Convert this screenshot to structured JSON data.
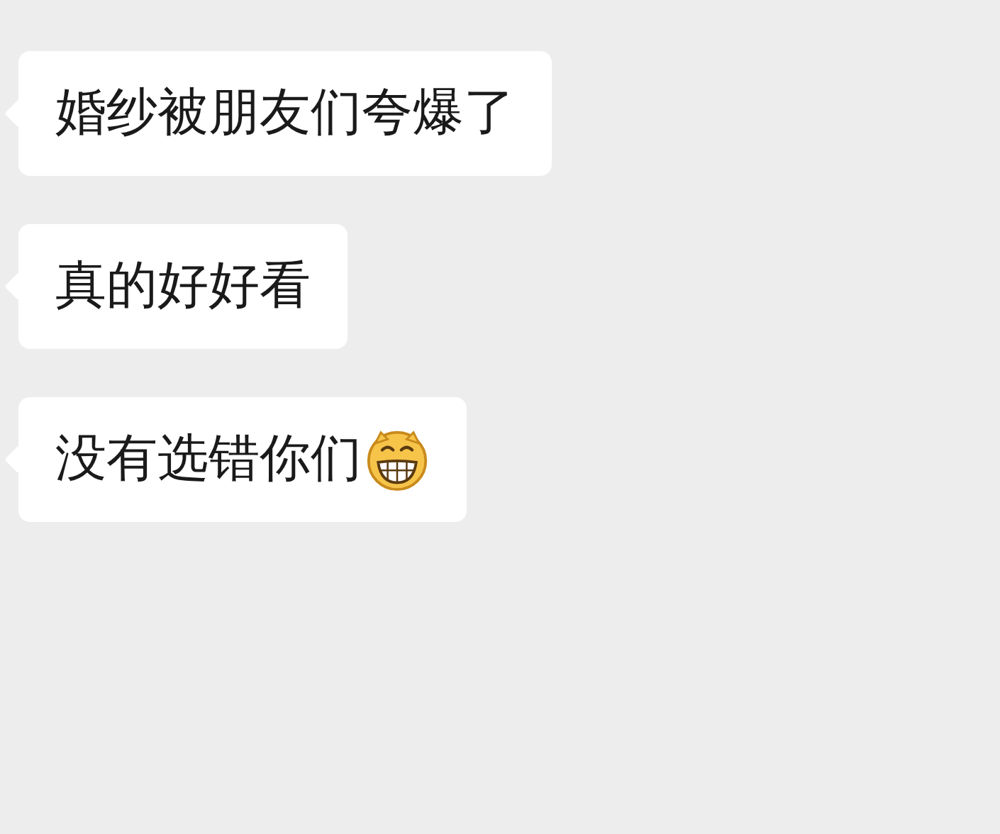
{
  "messages": [
    {
      "text": "婚纱被朋友们夸爆了",
      "emoji": false
    },
    {
      "text": "真的好好看",
      "emoji": false
    },
    {
      "text": "没有选错你们",
      "emoji": true
    }
  ]
}
